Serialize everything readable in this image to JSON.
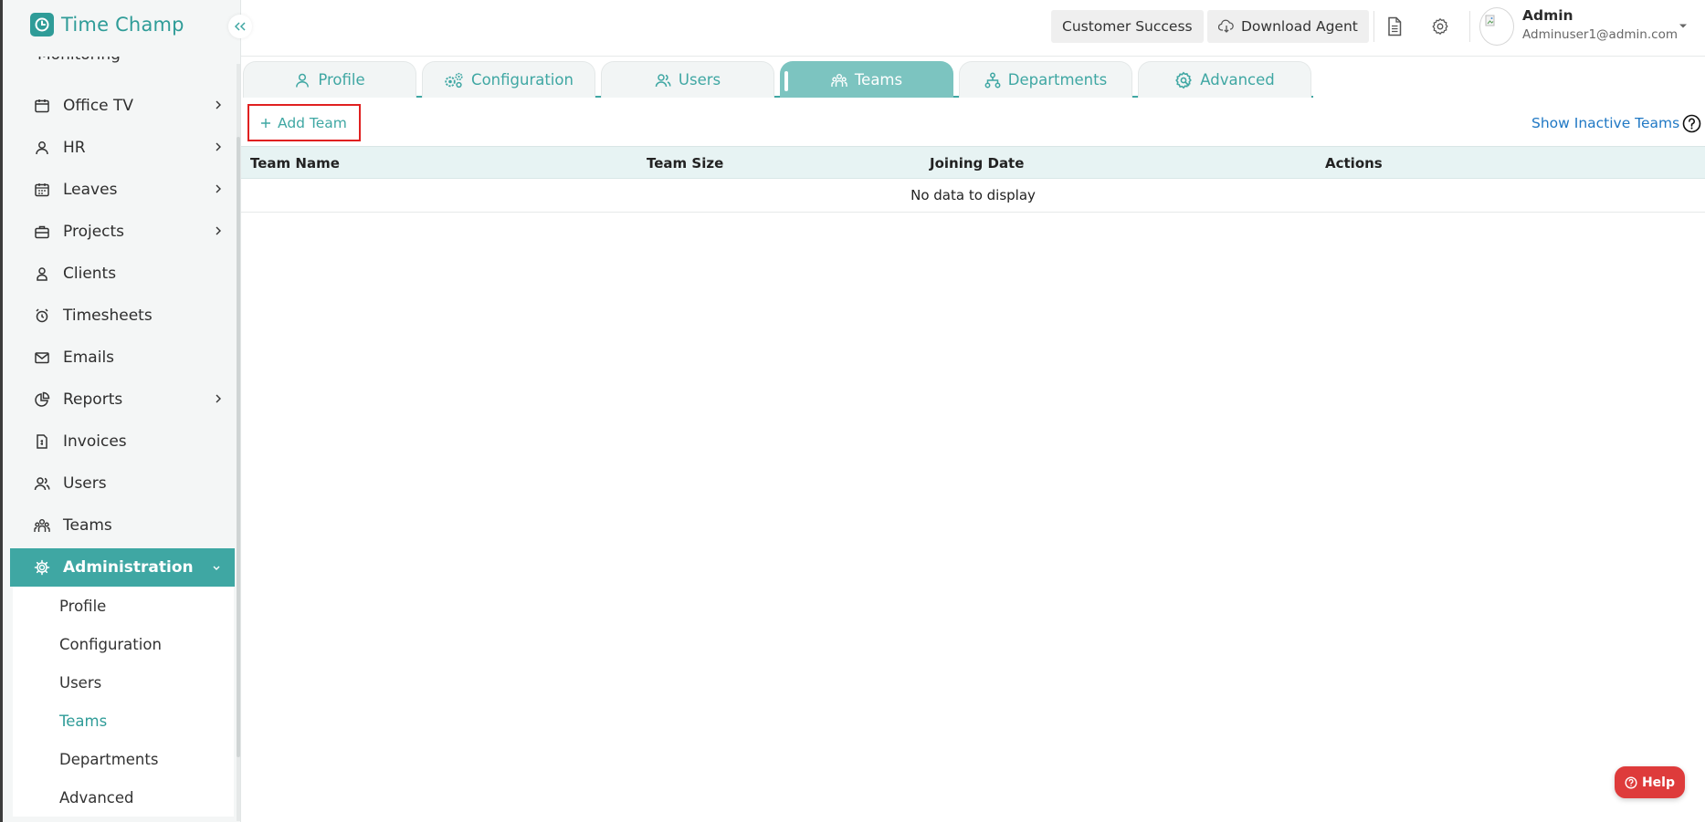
{
  "app": {
    "name": "Time Champ"
  },
  "sidebar": {
    "cutoff_item": "Monitoring",
    "items": [
      {
        "label": "Office TV",
        "icon": "calendar-icon",
        "has_chevron": true
      },
      {
        "label": "HR",
        "icon": "person-icon",
        "has_chevron": true
      },
      {
        "label": "Leaves",
        "icon": "calendar-grid-icon",
        "has_chevron": true
      },
      {
        "label": "Projects",
        "icon": "briefcase-icon",
        "has_chevron": true
      },
      {
        "label": "Clients",
        "icon": "client-icon",
        "has_chevron": false
      },
      {
        "label": "Timesheets",
        "icon": "alarm-clock-icon",
        "has_chevron": false
      },
      {
        "label": "Emails",
        "icon": "mail-icon",
        "has_chevron": false
      },
      {
        "label": "Reports",
        "icon": "pie-chart-icon",
        "has_chevron": true
      },
      {
        "label": "Invoices",
        "icon": "invoice-icon",
        "has_chevron": false
      },
      {
        "label": "Users",
        "icon": "users-icon",
        "has_chevron": false
      },
      {
        "label": "Teams",
        "icon": "teams-icon",
        "has_chevron": false
      }
    ],
    "active_section": {
      "label": "Administration",
      "icon": "gear-icon"
    },
    "sub_items": [
      {
        "label": "Profile",
        "active": false
      },
      {
        "label": "Configuration",
        "active": false
      },
      {
        "label": "Users",
        "active": false
      },
      {
        "label": "Teams",
        "active": true
      },
      {
        "label": "Departments",
        "active": false
      },
      {
        "label": "Advanced",
        "active": false
      }
    ]
  },
  "header": {
    "customer_success": "Customer Success",
    "download_agent": "Download Agent",
    "user": {
      "name": "Admin",
      "email": "Adminuser1@admin.com"
    }
  },
  "tabs": [
    {
      "label": "Profile",
      "icon": "person-icon",
      "active": false
    },
    {
      "label": "Configuration",
      "icon": "gears-icon",
      "active": false
    },
    {
      "label": "Users",
      "icon": "users-icon",
      "active": false
    },
    {
      "label": "Teams",
      "icon": "teams-icon",
      "active": true
    },
    {
      "label": "Departments",
      "icon": "hierarchy-icon",
      "active": false
    },
    {
      "label": "Advanced",
      "icon": "advanced-gear-icon",
      "active": false
    }
  ],
  "toolbar": {
    "add_team": "Add Team",
    "show_inactive": "Show Inactive Teams"
  },
  "table": {
    "columns": [
      "Team Name",
      "Team Size",
      "Joining Date",
      "Actions"
    ],
    "empty_text": "No data to display"
  },
  "help_button": "Help",
  "colors": {
    "accent": "#3fa7a3",
    "active_tab": "#7cc4c0",
    "link": "#1f78c4",
    "help": "#de3b3b",
    "highlight": "#e02020"
  }
}
